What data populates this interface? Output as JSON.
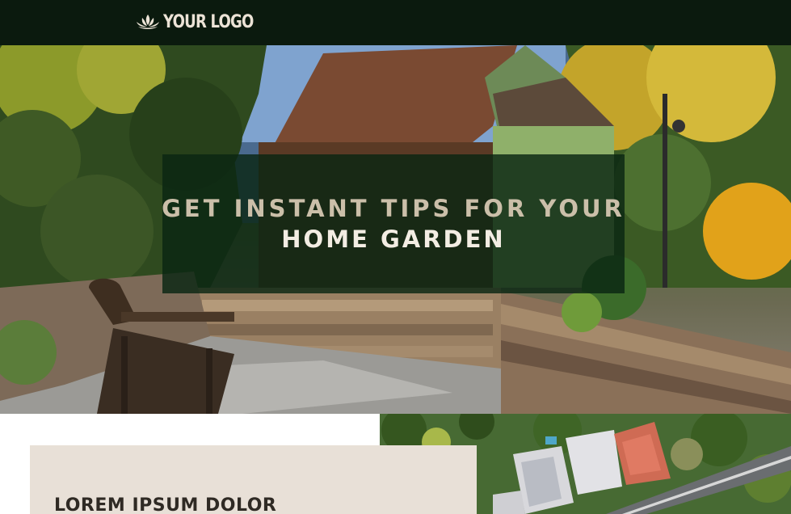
{
  "header": {
    "logo_text": "YOUR LOGO",
    "logo_icon": "lotus-icon",
    "background": "#0b1a0e"
  },
  "hero": {
    "headline_line1": "GET INSTANT TIPS FOR YOUR",
    "headline_line2": "HOME GARDEN",
    "overlay_color": "#0a2612",
    "image": "garden-house-photo"
  },
  "content": {
    "card_title": "LOREM IPSUM DOLOR",
    "card_color": "#e8e0d7",
    "side_image": "aerial-neighborhood-photo"
  }
}
